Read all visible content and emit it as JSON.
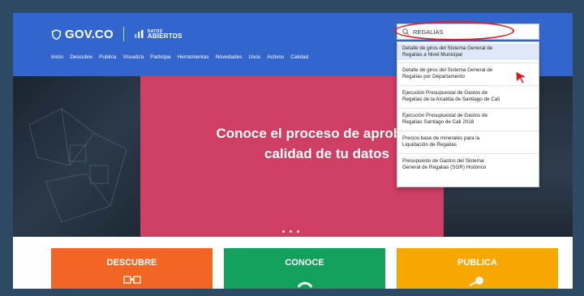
{
  "header": {
    "gov_logo": "GOV.CO",
    "datos_small": "DATOS",
    "datos_big": "ABIERTOS",
    "nav": [
      "Inicio",
      "Descubre",
      "Publica",
      "Visualiza",
      "Participa",
      "Herramientas",
      "Novedades",
      "Usos",
      "Activos",
      "Calidad"
    ]
  },
  "search": {
    "value": "REGALIAS",
    "icon": "search-icon",
    "suggestions": [
      {
        "line1": "Detalle de giros del Sistema General de",
        "line2": "Regalias a Nivel Municipal"
      },
      {
        "line1": "Detalle de giros del Sistema General de",
        "line2": "Regalias por Departamento"
      },
      {
        "line1": "Ejecución Presupuestal de Gastos de",
        "line2": "Regalias de la Alcaldia de Santiago de Cali"
      },
      {
        "line1": "Ejecución Presupuestal de Gastos de",
        "line2": "Regalias Santiago de Cali 2018"
      },
      {
        "line1": "Precios base de minerales para la",
        "line2": "Liquidación de Regalias"
      },
      {
        "line1": "Presupuesto de Gastos del Sistema",
        "line2": "General de Regalias (SGR) Histórico"
      }
    ]
  },
  "hero": {
    "line1": "Conoce el proceso de aprobación",
    "line2": "calidad de tu datos",
    "slides": 3
  },
  "cards": [
    {
      "label": "DESCUBRE",
      "color": "#f26522",
      "icon": "binoculars-icon"
    },
    {
      "label": "CONOCE",
      "color": "#12a05c",
      "icon": "cycle-icon"
    },
    {
      "label": "PUBLICA",
      "color": "#f6a800",
      "icon": "upload-icon"
    }
  ],
  "colors": {
    "header_bg": "#3366cc",
    "hero_panel": "#cf3e63",
    "annotation": "#e02020",
    "outer_bg": "#2c4a63"
  }
}
